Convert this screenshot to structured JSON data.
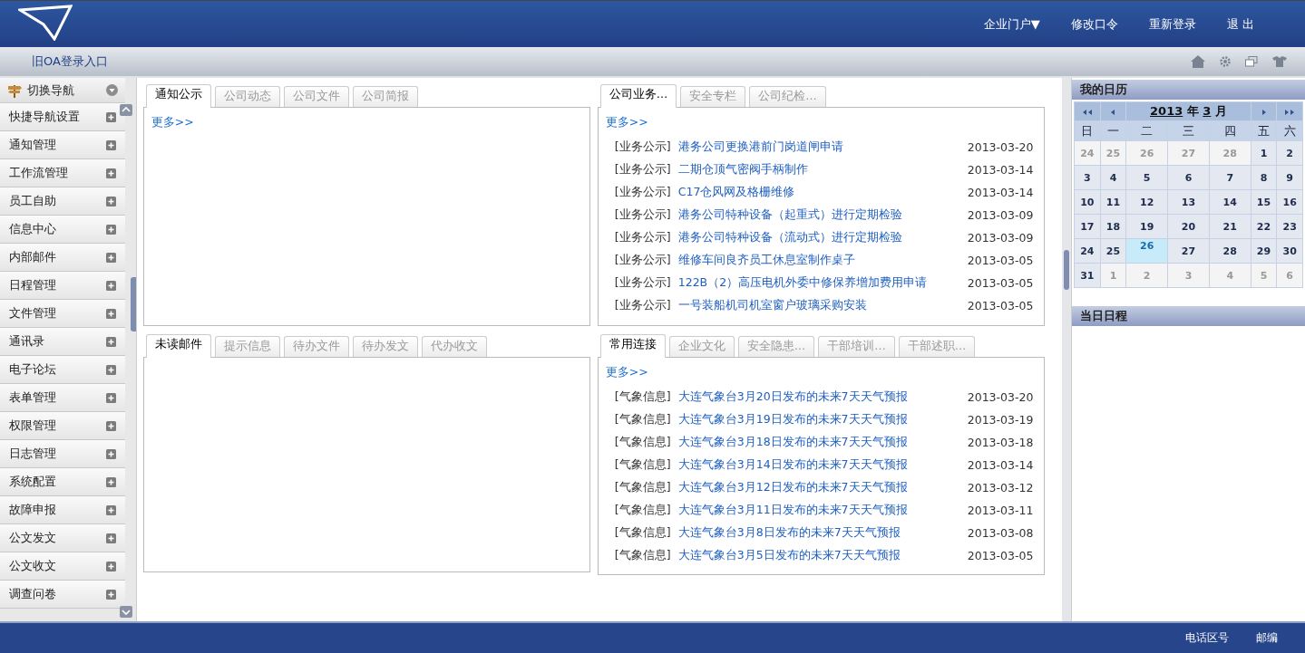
{
  "header": {
    "nav_links": [
      {
        "label": "企业门户▼"
      },
      {
        "label": "修改口令"
      },
      {
        "label": "重新登录"
      },
      {
        "label": "退 出"
      }
    ]
  },
  "toolbar": {
    "link": "旧OA登录入口"
  },
  "sidebar": {
    "title": "切换导航",
    "items": [
      "快捷导航设置",
      "通知管理",
      "工作流管理",
      "员工自助",
      "信息中心",
      "内部邮件",
      "日程管理",
      "文件管理",
      "通讯录",
      "电子论坛",
      "表单管理",
      "权限管理",
      "日志管理",
      "系统配置",
      "故障申报",
      "公文发文",
      "公文收文",
      "调查问卷"
    ]
  },
  "panels": [
    {
      "tabs": [
        {
          "label": "通知公示",
          "selected": true
        },
        {
          "label": "公司动态",
          "selected": false
        },
        {
          "label": "公司文件",
          "selected": false
        },
        {
          "label": "公司简报",
          "selected": false
        }
      ],
      "more": "更多>>"
    },
    {
      "tabs": [
        {
          "label": "公司业务…",
          "selected": true
        },
        {
          "label": "安全专栏",
          "selected": false
        },
        {
          "label": "公司纪检…",
          "selected": false
        }
      ],
      "more": "更多>>",
      "items": [
        {
          "category": "[业务公示]",
          "title": "港务公司更换港前门岗道闸申请",
          "date": "2013-03-20"
        },
        {
          "category": "[业务公示]",
          "title": "二期仓顶气密阀手柄制作",
          "date": "2013-03-14"
        },
        {
          "category": "[业务公示]",
          "title": "C17仓风网及格栅维修",
          "date": "2013-03-14"
        },
        {
          "category": "[业务公示]",
          "title": "港务公司特种设备（起重式）进行定期检验",
          "date": "2013-03-09"
        },
        {
          "category": "[业务公示]",
          "title": "港务公司特种设备（流动式）进行定期检验",
          "date": "2013-03-09"
        },
        {
          "category": "[业务公示]",
          "title": "维修车间良齐员工休息室制作桌子",
          "date": "2013-03-05"
        },
        {
          "category": "[业务公示]",
          "title": "122B（2）高压电机外委中修保养增加费用申请",
          "date": "2013-03-05"
        },
        {
          "category": "[业务公示]",
          "title": "一号装船机司机室窗户玻璃采购安装",
          "date": "2013-03-05"
        }
      ]
    },
    {
      "tabs": [
        {
          "label": "未读邮件",
          "selected": true
        },
        {
          "label": "提示信息",
          "selected": false
        },
        {
          "label": "待办文件",
          "selected": false
        },
        {
          "label": "待办发文",
          "selected": false
        },
        {
          "label": "代办收文",
          "selected": false
        }
      ]
    },
    {
      "tabs": [
        {
          "label": "常用连接",
          "selected": true
        },
        {
          "label": "企业文化",
          "selected": false
        },
        {
          "label": "安全隐患…",
          "selected": false
        },
        {
          "label": "干部培训…",
          "selected": false
        },
        {
          "label": "干部述职…",
          "selected": false
        }
      ],
      "more": "更多>>",
      "items": [
        {
          "category": "[气象信息]",
          "title": "大连气象台3月20日发布的未来7天天气预报",
          "date": "2013-03-20"
        },
        {
          "category": "[气象信息]",
          "title": "大连气象台3月19日发布的未来7天天气预报",
          "date": "2013-03-19"
        },
        {
          "category": "[气象信息]",
          "title": "大连气象台3月18日发布的未来7天天气预报",
          "date": "2013-03-18"
        },
        {
          "category": "[气象信息]",
          "title": "大连气象台3月14日发布的未来7天天气预报",
          "date": "2013-03-14"
        },
        {
          "category": "[气象信息]",
          "title": "大连气象台3月12日发布的未来7天天气预报",
          "date": "2013-03-12"
        },
        {
          "category": "[气象信息]",
          "title": "大连气象台3月11日发布的未来7天天气预报",
          "date": "2013-03-11"
        },
        {
          "category": "[气象信息]",
          "title": "大连气象台3月8日发布的未来7天天气预报",
          "date": "2013-03-08"
        },
        {
          "category": "[气象信息]",
          "title": "大连气象台3月5日发布的未来7天天气预报",
          "date": "2013-03-05"
        }
      ]
    }
  ],
  "calendar": {
    "title": "我的日历",
    "year": "2013",
    "year_unit": "年",
    "month": "3",
    "month_unit": "月",
    "weekdays": [
      "日",
      "一",
      "二",
      "三",
      "四",
      "五",
      "六"
    ],
    "days": [
      {
        "day": "24",
        "kind": "other",
        "selected": false
      },
      {
        "day": "25",
        "kind": "other",
        "selected": false
      },
      {
        "day": "26",
        "kind": "other",
        "selected": false
      },
      {
        "day": "27",
        "kind": "other",
        "selected": false
      },
      {
        "day": "28",
        "kind": "other",
        "selected": false
      },
      {
        "day": "1",
        "kind": "current",
        "selected": false
      },
      {
        "day": "2",
        "kind": "current",
        "selected": false
      },
      {
        "day": "3",
        "kind": "current",
        "selected": false
      },
      {
        "day": "4",
        "kind": "current",
        "selected": false
      },
      {
        "day": "5",
        "kind": "current",
        "selected": false
      },
      {
        "day": "6",
        "kind": "current",
        "selected": false
      },
      {
        "day": "7",
        "kind": "current",
        "selected": false
      },
      {
        "day": "8",
        "kind": "current",
        "selected": false
      },
      {
        "day": "9",
        "kind": "current",
        "selected": false
      },
      {
        "day": "10",
        "kind": "current",
        "selected": false
      },
      {
        "day": "11",
        "kind": "current",
        "selected": false
      },
      {
        "day": "12",
        "kind": "current",
        "selected": false
      },
      {
        "day": "13",
        "kind": "current",
        "selected": false
      },
      {
        "day": "14",
        "kind": "current",
        "selected": false
      },
      {
        "day": "15",
        "kind": "current",
        "selected": false
      },
      {
        "day": "16",
        "kind": "current",
        "selected": false
      },
      {
        "day": "17",
        "kind": "current",
        "selected": false
      },
      {
        "day": "18",
        "kind": "current",
        "selected": false
      },
      {
        "day": "19",
        "kind": "current",
        "selected": false
      },
      {
        "day": "20",
        "kind": "current",
        "selected": false
      },
      {
        "day": "21",
        "kind": "current",
        "selected": false
      },
      {
        "day": "22",
        "kind": "current",
        "selected": false
      },
      {
        "day": "23",
        "kind": "current",
        "selected": false
      },
      {
        "day": "24",
        "kind": "current",
        "selected": false
      },
      {
        "day": "25",
        "kind": "current",
        "selected": false
      },
      {
        "day": "26",
        "kind": "current",
        "selected": true
      },
      {
        "day": "27",
        "kind": "current",
        "selected": false
      },
      {
        "day": "28",
        "kind": "current",
        "selected": false
      },
      {
        "day": "29",
        "kind": "current",
        "selected": false
      },
      {
        "day": "30",
        "kind": "current",
        "selected": false
      },
      {
        "day": "31",
        "kind": "current",
        "selected": false
      },
      {
        "day": "1",
        "kind": "other",
        "selected": false
      },
      {
        "day": "2",
        "kind": "other",
        "selected": false
      },
      {
        "day": "3",
        "kind": "other",
        "selected": false
      },
      {
        "day": "4",
        "kind": "other",
        "selected": false
      },
      {
        "day": "5",
        "kind": "other",
        "selected": false
      },
      {
        "day": "6",
        "kind": "other",
        "selected": false
      }
    ]
  },
  "schedule": {
    "title": "当日日程"
  },
  "footer": {
    "items": [
      "电话区号",
      "邮编"
    ]
  }
}
